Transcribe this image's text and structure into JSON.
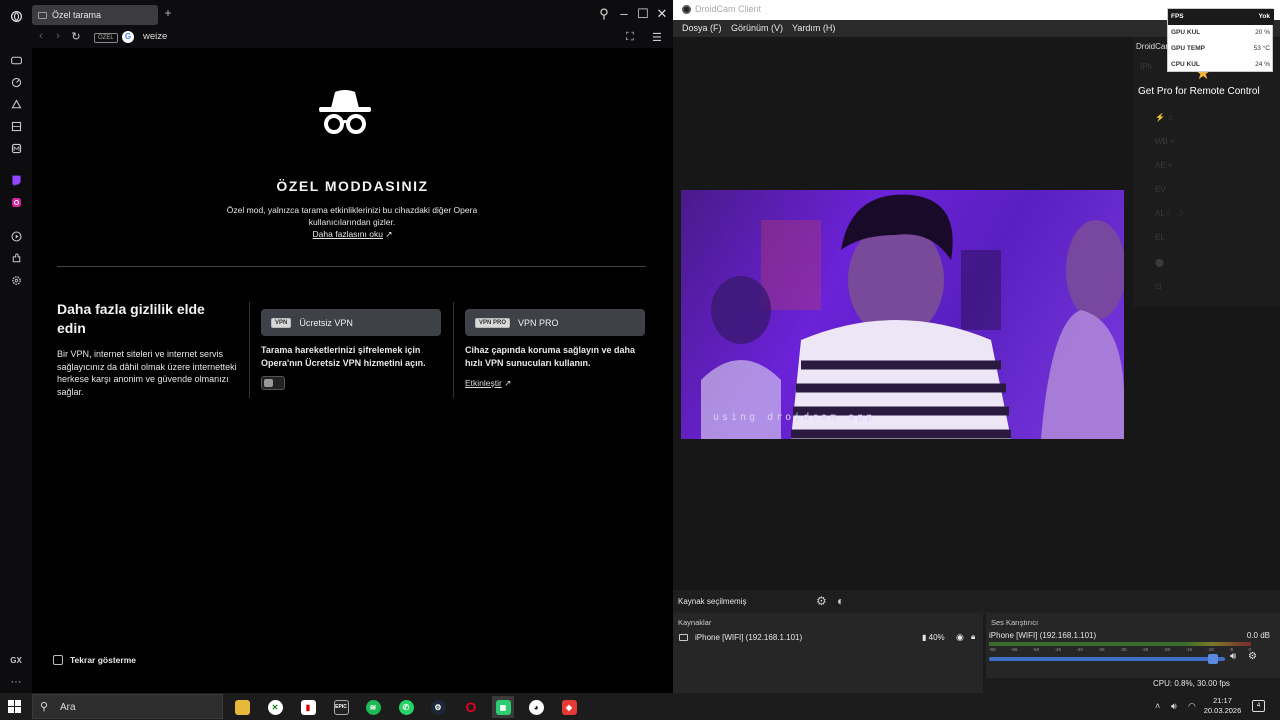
{
  "opera": {
    "tab_title": "Özel tarama",
    "private_badge": "ÖZEL",
    "url": "weize",
    "title": "ÖZEL MODDASINIZ",
    "description": "Özel mod, yalnızca tarama etkinliklerinizi bu cihazdaki diğer Opera kullanıcılarından gizler.",
    "learn_more": "Daha fazlasını oku",
    "vpn_heading": "Daha fazla gizlilik elde edin",
    "vpn_description": "Bir VPN, internet siteleri ve internet servis sağlayıcınız da dâhil olmak üzere internetteki herkese karşı anonim ve güvende olmanızı sağlar.",
    "free_vpn": {
      "badge": "VPN",
      "label": "Ücretsiz VPN",
      "description": "Tarama hareketlerinizi şifrelemek için Opera'nın Ücretsiz VPN hizmetini açın.",
      "enabled": false
    },
    "vpn_pro": {
      "badge": "VPN PRO",
      "label": "VPN PRO",
      "description": "Cihaz çapında koruma sağlayın ve daha hızlı VPN sunucuları kullanın.",
      "link": "Etkinleştir"
    },
    "dont_show": "Tekrar gösterme",
    "sidebar_gx": "GX",
    "sidebar_more": "···"
  },
  "droidcam": {
    "window_title": "DroidCam Client",
    "menu": [
      "Dosya (F)",
      "Görünüm (V)",
      "Yardım (H)"
    ],
    "side_label": "DroidCam",
    "side_controls": [
      "IPh",
      "⚡ ♫",
      "WB ˅",
      "AE ˅",
      "EV",
      "AL ☾ ☽",
      "EL",
      "⬤",
      "⊡"
    ],
    "pro_text": "Get Pro for Remote Control",
    "video_watermark": "using droidcam.app",
    "status_text": "Kaynak seçilmemiş",
    "sources_header": "Kaynaklar",
    "source_name": "iPhone [WIFI] (192.168.1.101)",
    "source_battery": "40%",
    "mixer_header": "Ses Karıştırıcı",
    "mixer_name": "iPhone [WIFI] (192.168.1.101)",
    "mixer_db": "0.0 dB",
    "mixer_ticks": [
      "-60",
      "-55",
      "-50",
      "-45",
      "-40",
      "-35",
      "-30",
      "-25",
      "-20",
      "-15",
      "-10",
      "-5",
      "0"
    ],
    "volume_level": 0.95,
    "cpu_fps": "CPU: 0.8%, 30.00 fps"
  },
  "overlay": {
    "rows": [
      {
        "key": "FPS",
        "value": "Yok"
      },
      {
        "key": "GPU KUL",
        "value": "20 %"
      },
      {
        "key": "GPU TEMP",
        "value": "53 °C"
      },
      {
        "key": "CPU KUL",
        "value": "24 %"
      }
    ]
  },
  "taskbar": {
    "search_placeholder": "Ara",
    "time": "21:17",
    "date": "20.03.2026",
    "notification_count": "4",
    "steam_badge": "1"
  }
}
